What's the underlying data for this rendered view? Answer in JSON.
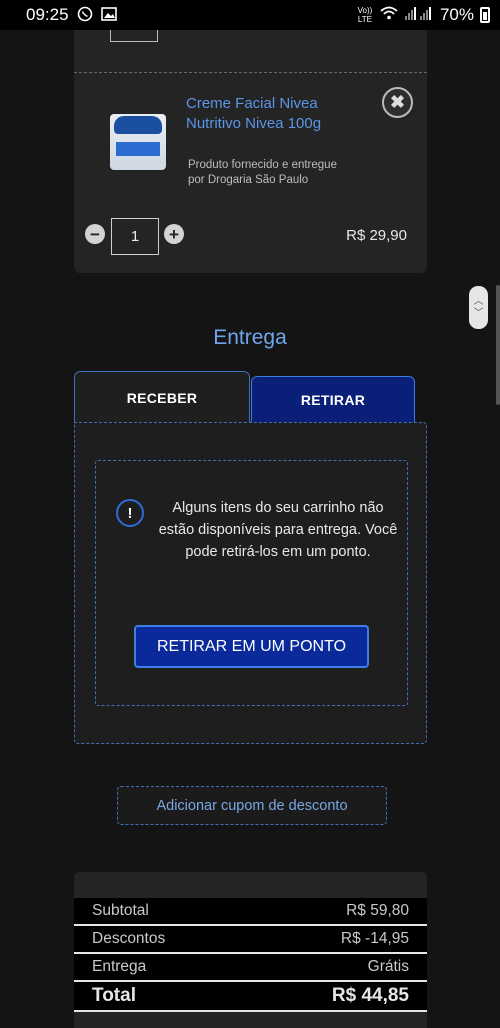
{
  "status_bar": {
    "time": "09:25",
    "network_label": "Vo)) LTE",
    "battery": "70%"
  },
  "cart_item": {
    "product_name": "Creme Facial Nivea Nutritivo Nivea 100g",
    "seller": "Produto fornecido e entregue por Drogaria São Paulo",
    "quantity": "1",
    "price": "R$ 29,90",
    "remove_symbol": "✖",
    "minus_symbol": "−",
    "plus_symbol": "+"
  },
  "delivery": {
    "title": "Entrega",
    "tabs": [
      {
        "label": "RECEBER",
        "selected": false
      },
      {
        "label": "RETIRAR",
        "selected": true
      }
    ],
    "notice_icon": "!",
    "notice_text": "Alguns itens do seu carrinho não estão disponíveis para entrega. Você pode retirá-los em um ponto.",
    "pickup_button": "RETIRAR EM UM PONTO"
  },
  "coupon": {
    "label": "Adicionar cupom de desconto"
  },
  "summary": {
    "rows": [
      {
        "label": "Subtotal",
        "value": "R$ 59,80"
      },
      {
        "label": "Descontos",
        "value": "R$ -14,95"
      },
      {
        "label": "Entrega",
        "value": "Grátis"
      },
      {
        "label": "Total",
        "value": "R$ 44,85"
      }
    ]
  },
  "colors": {
    "accent": "#5b95e6",
    "selected_tab": "#0a1f78",
    "button_blue": "#0a2a9c",
    "background": "#141414",
    "card": "#242424"
  }
}
